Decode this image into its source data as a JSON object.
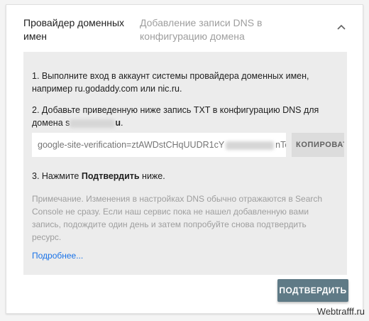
{
  "header": {
    "title": "Провайдер доменных имен",
    "description": "Добавление записи DNS в конфигурацию домена"
  },
  "steps": {
    "step1": "1. Выполните вход в аккаунт системы провайдера доменных имен, например ru.godaddy.com или nic.ru.",
    "step2_prefix": "2. Добавьте приведенную ниже запись TXT в конфигурацию DNS для домена s",
    "step2_suffix": "u",
    "step2_end": ".",
    "step3_prefix": "3. Нажмите ",
    "step3_bold": "Подтвердить",
    "step3_suffix": " ниже."
  },
  "verification": {
    "code_prefix": "google-site-verification=ztAWDstCHqUUDR1cY",
    "code_suffix": "nTcUI",
    "copy_label": "КОПИРОВАТЬ"
  },
  "note": "Примечание. Изменения в настройках DNS обычно отражаются в Search Console не сразу. Если наш сервис пока не нашел добавленную вами запись, подождите один день и затем попробуйте снова подтвердить ресурс.",
  "more_link": "Подробнее...",
  "confirm_label": "ПОДТВЕРДИТЬ",
  "watermark": "Webtrafff.ru",
  "colors": {
    "accent_link": "#1a73e8",
    "confirm_button": "#5f7a86",
    "panel_bg": "#ececec"
  },
  "icons": {
    "collapse": "chevron-up-icon"
  }
}
